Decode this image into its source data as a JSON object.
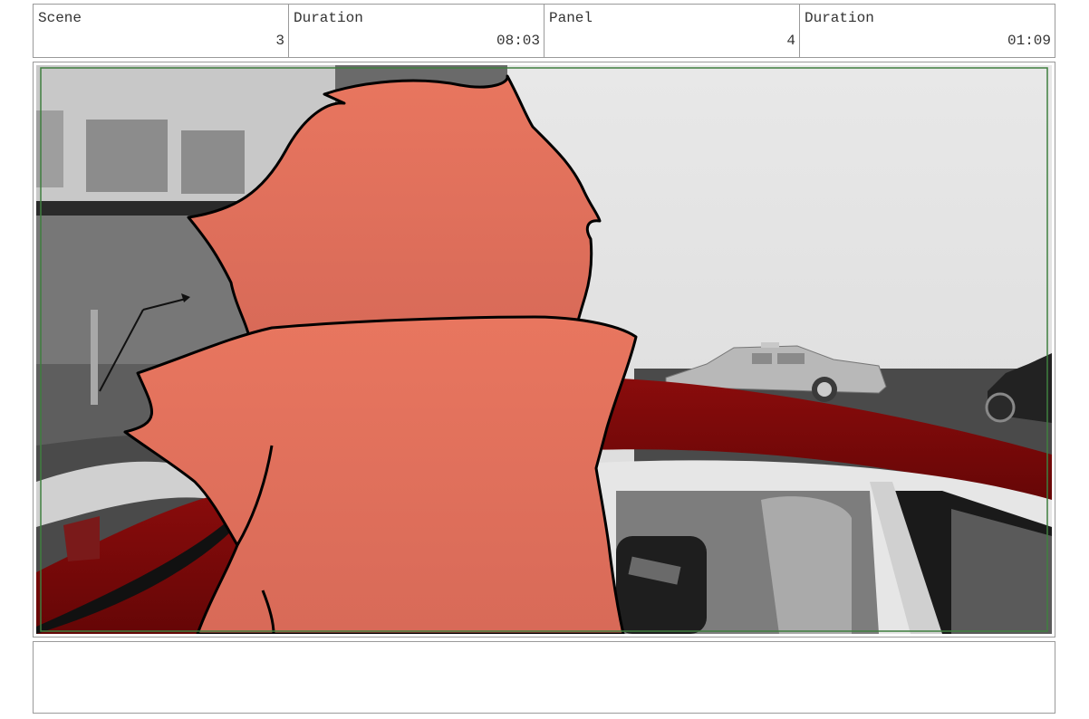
{
  "info": {
    "scene_label": "Scene",
    "scene_value": "3",
    "scene_duration_label": "Duration",
    "scene_duration_value": "08:03",
    "panel_label": "Panel",
    "panel_value": "4",
    "panel_duration_label": "Duration",
    "panel_duration_value": "01:09"
  },
  "notes": {
    "text": ""
  },
  "colors": {
    "safe_frame": "#3f7f3f",
    "character_fill": "#e07560",
    "car_red": "#7a0a0a"
  }
}
